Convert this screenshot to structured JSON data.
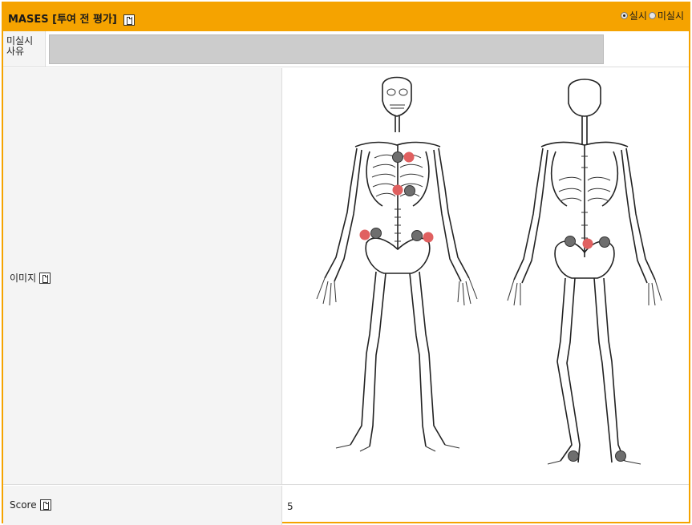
{
  "header": {
    "title": "MASES [투여 전 평가]",
    "options": [
      {
        "label": "실시",
        "checked": true
      },
      {
        "label": "미실시",
        "checked": false
      }
    ]
  },
  "reason_row": {
    "label_line1": "미실시",
    "label_line2": "사유",
    "value": ""
  },
  "image_row": {
    "label": "이미지"
  },
  "score_row": {
    "label": "Score",
    "value": "5"
  },
  "markers": {
    "red_color": "#e06060",
    "gray_color": "#6e6e6e"
  }
}
